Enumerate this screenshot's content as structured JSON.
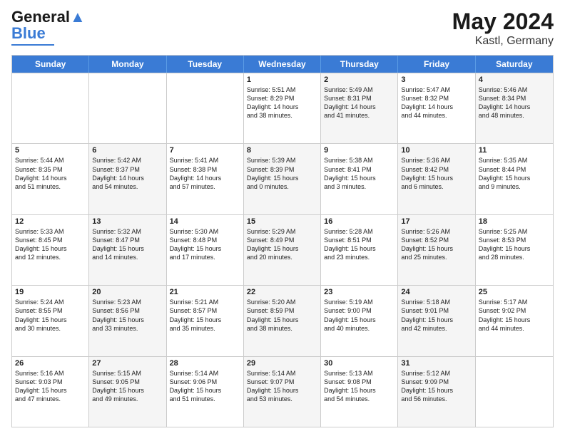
{
  "header": {
    "logo_general": "General",
    "logo_blue": "Blue",
    "month_year": "May 2024",
    "location": "Kastl, Germany"
  },
  "days_of_week": [
    "Sunday",
    "Monday",
    "Tuesday",
    "Wednesday",
    "Thursday",
    "Friday",
    "Saturday"
  ],
  "rows": [
    [
      {
        "day": "",
        "empty": true,
        "shaded": false,
        "lines": []
      },
      {
        "day": "",
        "empty": true,
        "shaded": false,
        "lines": []
      },
      {
        "day": "",
        "empty": true,
        "shaded": false,
        "lines": []
      },
      {
        "day": "1",
        "empty": false,
        "shaded": false,
        "lines": [
          "Sunrise: 5:51 AM",
          "Sunset: 8:29 PM",
          "Daylight: 14 hours",
          "and 38 minutes."
        ]
      },
      {
        "day": "2",
        "empty": false,
        "shaded": true,
        "lines": [
          "Sunrise: 5:49 AM",
          "Sunset: 8:31 PM",
          "Daylight: 14 hours",
          "and 41 minutes."
        ]
      },
      {
        "day": "3",
        "empty": false,
        "shaded": false,
        "lines": [
          "Sunrise: 5:47 AM",
          "Sunset: 8:32 PM",
          "Daylight: 14 hours",
          "and 44 minutes."
        ]
      },
      {
        "day": "4",
        "empty": false,
        "shaded": true,
        "lines": [
          "Sunrise: 5:46 AM",
          "Sunset: 8:34 PM",
          "Daylight: 14 hours",
          "and 48 minutes."
        ]
      }
    ],
    [
      {
        "day": "5",
        "empty": false,
        "shaded": false,
        "lines": [
          "Sunrise: 5:44 AM",
          "Sunset: 8:35 PM",
          "Daylight: 14 hours",
          "and 51 minutes."
        ]
      },
      {
        "day": "6",
        "empty": false,
        "shaded": true,
        "lines": [
          "Sunrise: 5:42 AM",
          "Sunset: 8:37 PM",
          "Daylight: 14 hours",
          "and 54 minutes."
        ]
      },
      {
        "day": "7",
        "empty": false,
        "shaded": false,
        "lines": [
          "Sunrise: 5:41 AM",
          "Sunset: 8:38 PM",
          "Daylight: 14 hours",
          "and 57 minutes."
        ]
      },
      {
        "day": "8",
        "empty": false,
        "shaded": true,
        "lines": [
          "Sunrise: 5:39 AM",
          "Sunset: 8:39 PM",
          "Daylight: 15 hours",
          "and 0 minutes."
        ]
      },
      {
        "day": "9",
        "empty": false,
        "shaded": false,
        "lines": [
          "Sunrise: 5:38 AM",
          "Sunset: 8:41 PM",
          "Daylight: 15 hours",
          "and 3 minutes."
        ]
      },
      {
        "day": "10",
        "empty": false,
        "shaded": true,
        "lines": [
          "Sunrise: 5:36 AM",
          "Sunset: 8:42 PM",
          "Daylight: 15 hours",
          "and 6 minutes."
        ]
      },
      {
        "day": "11",
        "empty": false,
        "shaded": false,
        "lines": [
          "Sunrise: 5:35 AM",
          "Sunset: 8:44 PM",
          "Daylight: 15 hours",
          "and 9 minutes."
        ]
      }
    ],
    [
      {
        "day": "12",
        "empty": false,
        "shaded": false,
        "lines": [
          "Sunrise: 5:33 AM",
          "Sunset: 8:45 PM",
          "Daylight: 15 hours",
          "and 12 minutes."
        ]
      },
      {
        "day": "13",
        "empty": false,
        "shaded": true,
        "lines": [
          "Sunrise: 5:32 AM",
          "Sunset: 8:47 PM",
          "Daylight: 15 hours",
          "and 14 minutes."
        ]
      },
      {
        "day": "14",
        "empty": false,
        "shaded": false,
        "lines": [
          "Sunrise: 5:30 AM",
          "Sunset: 8:48 PM",
          "Daylight: 15 hours",
          "and 17 minutes."
        ]
      },
      {
        "day": "15",
        "empty": false,
        "shaded": true,
        "lines": [
          "Sunrise: 5:29 AM",
          "Sunset: 8:49 PM",
          "Daylight: 15 hours",
          "and 20 minutes."
        ]
      },
      {
        "day": "16",
        "empty": false,
        "shaded": false,
        "lines": [
          "Sunrise: 5:28 AM",
          "Sunset: 8:51 PM",
          "Daylight: 15 hours",
          "and 23 minutes."
        ]
      },
      {
        "day": "17",
        "empty": false,
        "shaded": true,
        "lines": [
          "Sunrise: 5:26 AM",
          "Sunset: 8:52 PM",
          "Daylight: 15 hours",
          "and 25 minutes."
        ]
      },
      {
        "day": "18",
        "empty": false,
        "shaded": false,
        "lines": [
          "Sunrise: 5:25 AM",
          "Sunset: 8:53 PM",
          "Daylight: 15 hours",
          "and 28 minutes."
        ]
      }
    ],
    [
      {
        "day": "19",
        "empty": false,
        "shaded": false,
        "lines": [
          "Sunrise: 5:24 AM",
          "Sunset: 8:55 PM",
          "Daylight: 15 hours",
          "and 30 minutes."
        ]
      },
      {
        "day": "20",
        "empty": false,
        "shaded": true,
        "lines": [
          "Sunrise: 5:23 AM",
          "Sunset: 8:56 PM",
          "Daylight: 15 hours",
          "and 33 minutes."
        ]
      },
      {
        "day": "21",
        "empty": false,
        "shaded": false,
        "lines": [
          "Sunrise: 5:21 AM",
          "Sunset: 8:57 PM",
          "Daylight: 15 hours",
          "and 35 minutes."
        ]
      },
      {
        "day": "22",
        "empty": false,
        "shaded": true,
        "lines": [
          "Sunrise: 5:20 AM",
          "Sunset: 8:59 PM",
          "Daylight: 15 hours",
          "and 38 minutes."
        ]
      },
      {
        "day": "23",
        "empty": false,
        "shaded": false,
        "lines": [
          "Sunrise: 5:19 AM",
          "Sunset: 9:00 PM",
          "Daylight: 15 hours",
          "and 40 minutes."
        ]
      },
      {
        "day": "24",
        "empty": false,
        "shaded": true,
        "lines": [
          "Sunrise: 5:18 AM",
          "Sunset: 9:01 PM",
          "Daylight: 15 hours",
          "and 42 minutes."
        ]
      },
      {
        "day": "25",
        "empty": false,
        "shaded": false,
        "lines": [
          "Sunrise: 5:17 AM",
          "Sunset: 9:02 PM",
          "Daylight: 15 hours",
          "and 44 minutes."
        ]
      }
    ],
    [
      {
        "day": "26",
        "empty": false,
        "shaded": false,
        "lines": [
          "Sunrise: 5:16 AM",
          "Sunset: 9:03 PM",
          "Daylight: 15 hours",
          "and 47 minutes."
        ]
      },
      {
        "day": "27",
        "empty": false,
        "shaded": true,
        "lines": [
          "Sunrise: 5:15 AM",
          "Sunset: 9:05 PM",
          "Daylight: 15 hours",
          "and 49 minutes."
        ]
      },
      {
        "day": "28",
        "empty": false,
        "shaded": false,
        "lines": [
          "Sunrise: 5:14 AM",
          "Sunset: 9:06 PM",
          "Daylight: 15 hours",
          "and 51 minutes."
        ]
      },
      {
        "day": "29",
        "empty": false,
        "shaded": true,
        "lines": [
          "Sunrise: 5:14 AM",
          "Sunset: 9:07 PM",
          "Daylight: 15 hours",
          "and 53 minutes."
        ]
      },
      {
        "day": "30",
        "empty": false,
        "shaded": false,
        "lines": [
          "Sunrise: 5:13 AM",
          "Sunset: 9:08 PM",
          "Daylight: 15 hours",
          "and 54 minutes."
        ]
      },
      {
        "day": "31",
        "empty": false,
        "shaded": true,
        "lines": [
          "Sunrise: 5:12 AM",
          "Sunset: 9:09 PM",
          "Daylight: 15 hours",
          "and 56 minutes."
        ]
      },
      {
        "day": "",
        "empty": true,
        "shaded": false,
        "lines": []
      }
    ]
  ]
}
